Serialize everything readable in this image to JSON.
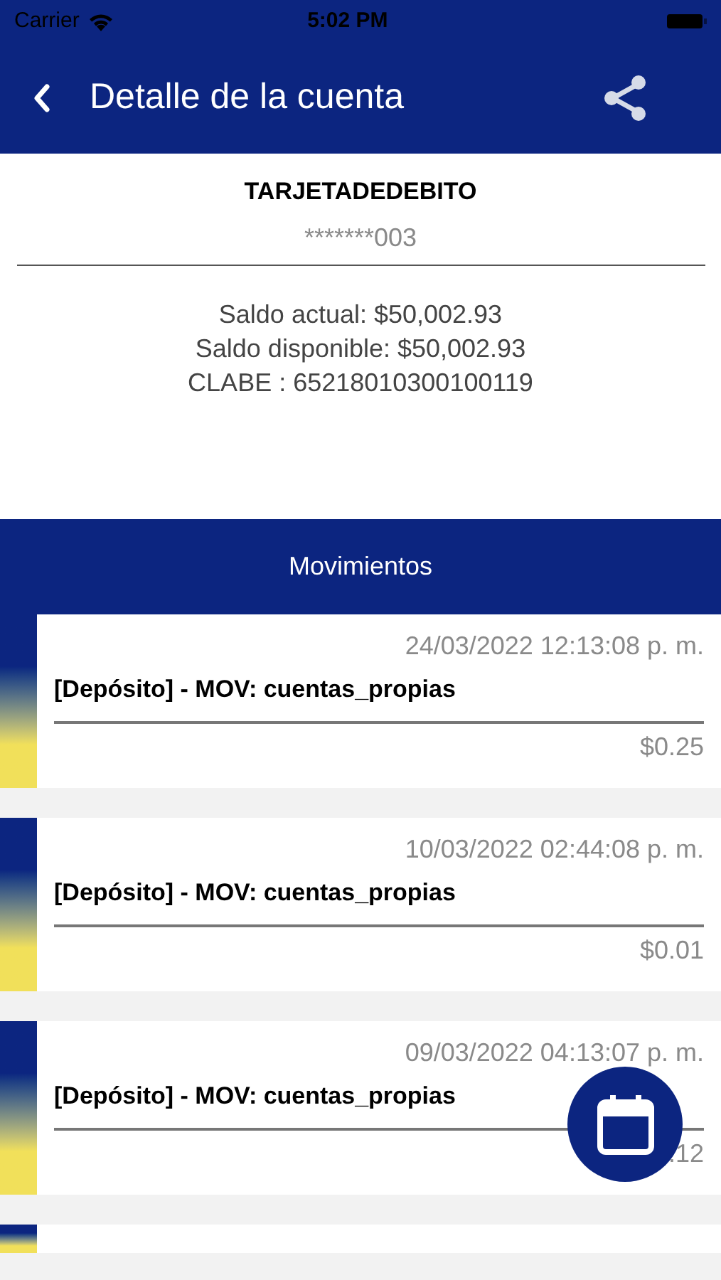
{
  "status_bar": {
    "carrier": "Carrier",
    "time": "5:02 PM"
  },
  "nav": {
    "title": "Detalle de la cuenta"
  },
  "account": {
    "name": "TARJETADEDEBITO",
    "number": "*******003",
    "lines": [
      "Saldo actual: $50,002.93",
      "Saldo disponible: $50,002.93",
      "CLABE : 65218010300100119"
    ]
  },
  "section_title": "Movimientos",
  "movements": [
    {
      "kind": "full",
      "date": "24/03/2022 12:13:08 p. m.",
      "description": "[Depósito] - MOV: cuentas_propias",
      "amount": "$0.25"
    },
    {
      "kind": "full",
      "date": "10/03/2022 02:44:08 p. m.",
      "description": "[Depósito] - MOV: cuentas_propias",
      "amount": "$0.01"
    },
    {
      "kind": "full",
      "date": "09/03/2022 04:13:07 p. m.",
      "description": "[Depósito] - MOV: cuentas_propias",
      "amount": ".12"
    },
    {
      "kind": "partial"
    }
  ]
}
